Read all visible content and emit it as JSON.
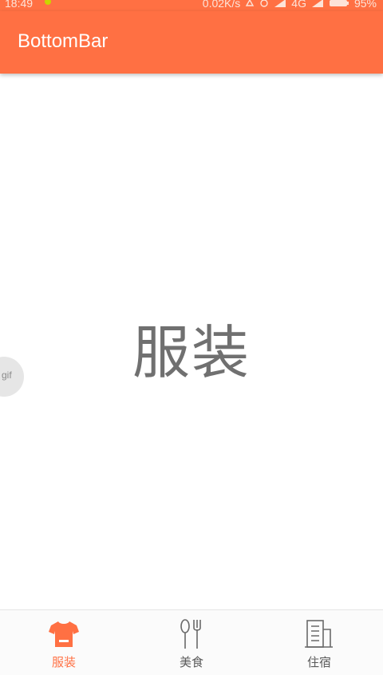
{
  "status_bar": {
    "time": "18:49",
    "net_speed": "0.02K/s",
    "network": "4G",
    "battery": "95%"
  },
  "app_bar": {
    "title": "BottomBar"
  },
  "content": {
    "text": "服装"
  },
  "gif_badge": {
    "label": "gif"
  },
  "bottom_bar": {
    "tabs": [
      {
        "label": "服装",
        "icon": "shirt-icon",
        "active": true
      },
      {
        "label": "美食",
        "icon": "fork-spoon-icon",
        "active": false
      },
      {
        "label": "住宿",
        "icon": "building-icon",
        "active": false
      }
    ]
  },
  "colors": {
    "primary": "#ff7043",
    "inactive": "#5a5a5a",
    "content_text": "#707070"
  }
}
